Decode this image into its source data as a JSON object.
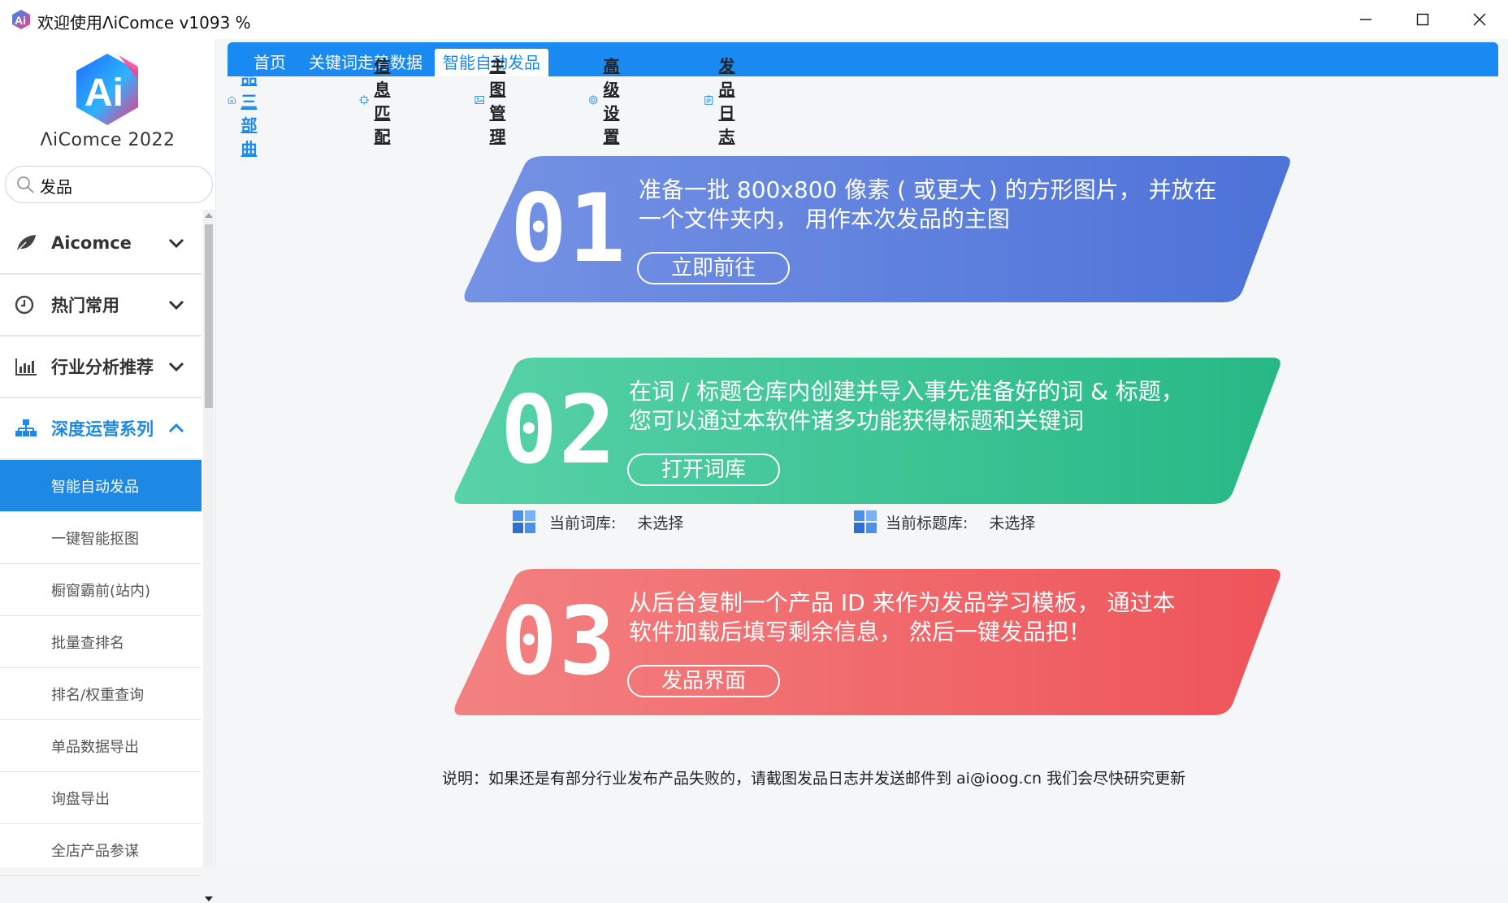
{
  "window": {
    "title": "欢迎使用ΛiComce v1093 %",
    "minimize_icon": "minimize-icon",
    "maximize_icon": "maximize-icon",
    "close_icon": "close-icon"
  },
  "sidebar": {
    "brand": "ΛiComce 2022",
    "search": {
      "value": "发品",
      "placeholder": ""
    },
    "groups": [
      {
        "label": "Aicomce",
        "icon": "leaf-icon",
        "expanded": false
      },
      {
        "label": "热门常用",
        "icon": "clock-icon",
        "expanded": false
      },
      {
        "label": "行业分析推荐",
        "icon": "bar-chart-icon",
        "expanded": false
      },
      {
        "label": "深度运营系列",
        "icon": "org-chart-icon",
        "expanded": true
      }
    ],
    "subitems": [
      {
        "label": "智能自动发品",
        "selected": true
      },
      {
        "label": "一键智能抠图"
      },
      {
        "label": "橱窗霸前(站内)"
      },
      {
        "label": "批量查排名"
      },
      {
        "label": "排名/权重查询"
      },
      {
        "label": "单品数据导出"
      },
      {
        "label": "询盘导出"
      },
      {
        "label": "全店产品参谋"
      }
    ]
  },
  "tabs": [
    {
      "label": "首页"
    },
    {
      "label": "关键词走势数据"
    },
    {
      "label": "智能自动发品",
      "active": true
    }
  ],
  "toolbar": [
    {
      "label": "发品三部曲",
      "icon": "home-icon",
      "active": true
    },
    {
      "label": "信息匹配",
      "icon": "crosshair-icon"
    },
    {
      "label": "主图管理",
      "icon": "image-icon"
    },
    {
      "label": "高级设置",
      "icon": "gear-icon"
    },
    {
      "label": "发品日志",
      "icon": "clipboard-icon"
    }
  ],
  "steps": [
    {
      "number": "01",
      "text_line1": "准备一批 800x800 像素 ( 或更大 ) 的方形图片，  并放在",
      "text_line2": "一个文件夹内，  用作本次发品的主图",
      "button": "立即前往",
      "color_a": "#6d8ce3",
      "color_b": "#5075d8"
    },
    {
      "number": "02",
      "text_line1": "在词 / 标题仓库内创建并导入事先准备好的词 & 标题，",
      "text_line2": "您可以通过本软件诸多功能获得标题和关键词",
      "button": "打开词库",
      "color_a": "#4fcfa4",
      "color_b": "#2cbb8b"
    },
    {
      "number": "03",
      "text_line1": "从后台复制一个产品 ID 来作为发品学习模板，  通过本",
      "text_line2": "软件加载后填写剩余信息，  然后一键发品把！",
      "button": "发品界面",
      "color_a": "#f27b7b",
      "color_b": "#ee5a5f"
    }
  ],
  "library": {
    "word_label": "当前词库:",
    "word_value": "未选择",
    "title_label": "当前标题库:",
    "title_value": "未选择",
    "icon": "windows-grid-icon"
  },
  "note": "说明：如果还是有部分行业发布产品失败的，请截图发品日志并发送邮件到 ai@ioog.cn 我们会尽快研究更新"
}
